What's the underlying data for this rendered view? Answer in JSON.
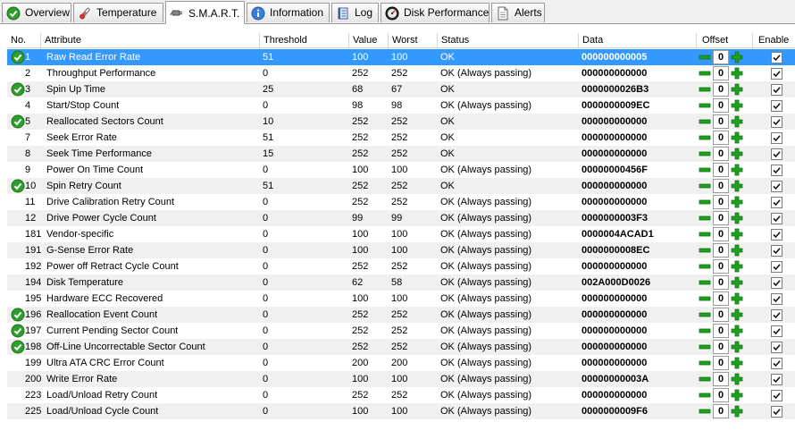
{
  "tabs": [
    {
      "label": "Overview",
      "icon": "check-circle-icon"
    },
    {
      "label": "Temperature",
      "icon": "thermometer-icon"
    },
    {
      "label": "S.M.A.R.T.",
      "icon": "plug-icon",
      "active": true
    },
    {
      "label": "Information",
      "icon": "info-icon"
    },
    {
      "label": "Log",
      "icon": "log-book-icon"
    },
    {
      "label": "Disk Performance",
      "icon": "gauge-icon"
    },
    {
      "label": "Alerts",
      "icon": "document-icon"
    }
  ],
  "columns": [
    "No.",
    "Attribute",
    "Threshold",
    "Value",
    "Worst",
    "Status",
    "Data",
    "Offset",
    "Enable"
  ],
  "colors": {
    "selected": "#3399ff",
    "ok_green": "#2e9e2e",
    "alt_row": "#f0f0f0"
  },
  "rows": [
    {
      "no": "1",
      "attribute": "Raw Read Error Rate",
      "threshold": "51",
      "value": "100",
      "worst": "100",
      "status": "OK",
      "data": "000000000005",
      "offset": "0",
      "ok": true,
      "selected": true
    },
    {
      "no": "2",
      "attribute": "Throughput Performance",
      "threshold": "0",
      "value": "252",
      "worst": "252",
      "status": "OK (Always passing)",
      "data": "000000000000",
      "offset": "0",
      "ok": false
    },
    {
      "no": "3",
      "attribute": "Spin Up Time",
      "threshold": "25",
      "value": "68",
      "worst": "67",
      "status": "OK",
      "data": "0000000026B3",
      "offset": "0",
      "ok": true
    },
    {
      "no": "4",
      "attribute": "Start/Stop Count",
      "threshold": "0",
      "value": "98",
      "worst": "98",
      "status": "OK (Always passing)",
      "data": "0000000009EC",
      "offset": "0",
      "ok": false
    },
    {
      "no": "5",
      "attribute": "Reallocated Sectors Count",
      "threshold": "10",
      "value": "252",
      "worst": "252",
      "status": "OK",
      "data": "000000000000",
      "offset": "0",
      "ok": true
    },
    {
      "no": "7",
      "attribute": "Seek Error Rate",
      "threshold": "51",
      "value": "252",
      "worst": "252",
      "status": "OK",
      "data": "000000000000",
      "offset": "0",
      "ok": false
    },
    {
      "no": "8",
      "attribute": "Seek Time Performance",
      "threshold": "15",
      "value": "252",
      "worst": "252",
      "status": "OK",
      "data": "000000000000",
      "offset": "0",
      "ok": false
    },
    {
      "no": "9",
      "attribute": "Power On Time Count",
      "threshold": "0",
      "value": "100",
      "worst": "100",
      "status": "OK (Always passing)",
      "data": "00000000456F",
      "offset": "0",
      "ok": false
    },
    {
      "no": "10",
      "attribute": "Spin Retry Count",
      "threshold": "51",
      "value": "252",
      "worst": "252",
      "status": "OK",
      "data": "000000000000",
      "offset": "0",
      "ok": true
    },
    {
      "no": "11",
      "attribute": "Drive Calibration Retry Count",
      "threshold": "0",
      "value": "252",
      "worst": "252",
      "status": "OK (Always passing)",
      "data": "000000000000",
      "offset": "0",
      "ok": false
    },
    {
      "no": "12",
      "attribute": "Drive Power Cycle Count",
      "threshold": "0",
      "value": "99",
      "worst": "99",
      "status": "OK (Always passing)",
      "data": "0000000003F3",
      "offset": "0",
      "ok": false
    },
    {
      "no": "181",
      "attribute": "Vendor-specific",
      "threshold": "0",
      "value": "100",
      "worst": "100",
      "status": "OK (Always passing)",
      "data": "0000004ACAD1",
      "offset": "0",
      "ok": false
    },
    {
      "no": "191",
      "attribute": "G-Sense Error Rate",
      "threshold": "0",
      "value": "100",
      "worst": "100",
      "status": "OK (Always passing)",
      "data": "0000000008EC",
      "offset": "0",
      "ok": false
    },
    {
      "no": "192",
      "attribute": "Power off Retract Cycle Count",
      "threshold": "0",
      "value": "252",
      "worst": "252",
      "status": "OK (Always passing)",
      "data": "000000000000",
      "offset": "0",
      "ok": false
    },
    {
      "no": "194",
      "attribute": "Disk Temperature",
      "threshold": "0",
      "value": "62",
      "worst": "58",
      "status": "OK (Always passing)",
      "data": "002A000D0026",
      "offset": "0",
      "ok": false
    },
    {
      "no": "195",
      "attribute": "Hardware ECC Recovered",
      "threshold": "0",
      "value": "100",
      "worst": "100",
      "status": "OK (Always passing)",
      "data": "000000000000",
      "offset": "0",
      "ok": false
    },
    {
      "no": "196",
      "attribute": "Reallocation Event Count",
      "threshold": "0",
      "value": "252",
      "worst": "252",
      "status": "OK (Always passing)",
      "data": "000000000000",
      "offset": "0",
      "ok": true
    },
    {
      "no": "197",
      "attribute": "Current Pending Sector Count",
      "threshold": "0",
      "value": "252",
      "worst": "252",
      "status": "OK (Always passing)",
      "data": "000000000000",
      "offset": "0",
      "ok": true
    },
    {
      "no": "198",
      "attribute": "Off-Line Uncorrectable Sector Count",
      "threshold": "0",
      "value": "252",
      "worst": "252",
      "status": "OK (Always passing)",
      "data": "000000000000",
      "offset": "0",
      "ok": true
    },
    {
      "no": "199",
      "attribute": "Ultra ATA CRC Error Count",
      "threshold": "0",
      "value": "200",
      "worst": "200",
      "status": "OK (Always passing)",
      "data": "000000000000",
      "offset": "0",
      "ok": false
    },
    {
      "no": "200",
      "attribute": "Write Error Rate",
      "threshold": "0",
      "value": "100",
      "worst": "100",
      "status": "OK (Always passing)",
      "data": "00000000003A",
      "offset": "0",
      "ok": false
    },
    {
      "no": "223",
      "attribute": "Load/Unload Retry Count",
      "threshold": "0",
      "value": "252",
      "worst": "252",
      "status": "OK (Always passing)",
      "data": "000000000000",
      "offset": "0",
      "ok": false
    },
    {
      "no": "225",
      "attribute": "Load/Unload Cycle Count",
      "threshold": "0",
      "value": "100",
      "worst": "100",
      "status": "OK (Always passing)",
      "data": "0000000009F6",
      "offset": "0",
      "ok": false
    }
  ]
}
